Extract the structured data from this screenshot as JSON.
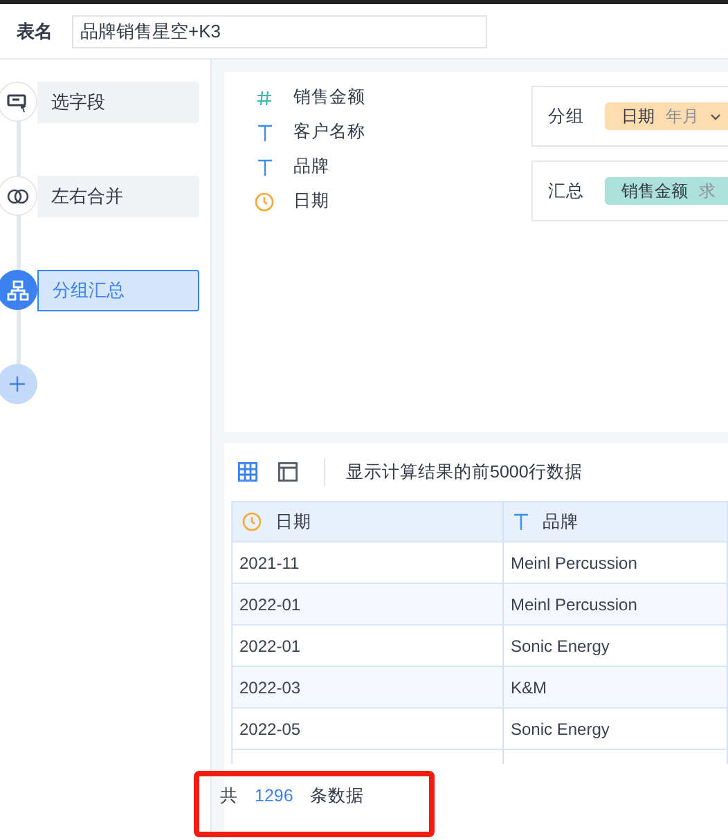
{
  "header": {
    "label": "表名",
    "value": "品牌销售星空+K3"
  },
  "steps": [
    {
      "kind": "select",
      "label": "选字段",
      "selected": false
    },
    {
      "kind": "merge",
      "label": "左右合并",
      "selected": false
    },
    {
      "kind": "group",
      "label": "分组汇总",
      "selected": true
    }
  ],
  "fields": [
    {
      "kind": "number",
      "label": "销售金额"
    },
    {
      "kind": "text",
      "label": "客户名称"
    },
    {
      "kind": "text",
      "label": "品牌"
    },
    {
      "kind": "date",
      "label": "日期"
    }
  ],
  "config": [
    {
      "label": "分组",
      "chips": [
        {
          "label": "日期",
          "option": "年月",
          "color": "#fddcb0",
          "dropdown": true
        }
      ]
    },
    {
      "label": "汇总",
      "chips": [
        {
          "label": "销售金额",
          "option": "求",
          "color": "#aee0da",
          "dropdown": false
        }
      ]
    }
  ],
  "toolbar": {
    "note": "显示计算结果的前5000行数据"
  },
  "table": {
    "columns": [
      {
        "kind": "date",
        "label": "日期"
      },
      {
        "kind": "text",
        "label": "品牌"
      }
    ],
    "rows": [
      [
        "2021-11",
        "Meinl Percussion"
      ],
      [
        "2022-01",
        "Meinl Percussion"
      ],
      [
        "2022-01",
        "Sonic Energy"
      ],
      [
        "2022-03",
        "K&M"
      ],
      [
        "2022-05",
        "Sonic Energy"
      ]
    ]
  },
  "footer": {
    "prefix": "共",
    "count": "1296",
    "suffix": "条数据"
  }
}
